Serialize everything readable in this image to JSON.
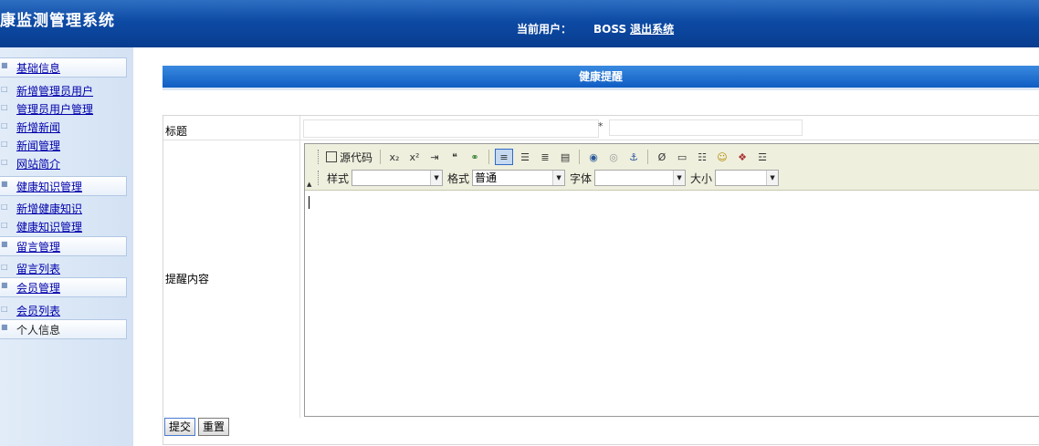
{
  "header": {
    "title": "康监测管理系统",
    "current_user_label": "当前用户：",
    "user_name": "BOSS",
    "logout_label": "退出系统"
  },
  "sidebar": {
    "sections": [
      {
        "label": "基础信息",
        "items": [
          "新增管理员用户",
          "管理员用户管理",
          "新增新闻",
          "新闻管理",
          "网站简介"
        ]
      },
      {
        "label": "健康知识管理",
        "items": [
          "新增健康知识",
          "健康知识管理"
        ]
      },
      {
        "label": "留言管理",
        "items": [
          "留言列表"
        ]
      },
      {
        "label": "会员管理",
        "items": [
          "会员列表"
        ]
      },
      {
        "label": "个人信息",
        "items": []
      }
    ]
  },
  "panel": {
    "title": "健康提醒"
  },
  "form": {
    "title_label": "标题",
    "title_value": "",
    "required_mark": "*",
    "content_label": "提醒内容"
  },
  "editor": {
    "source_label": "源代码",
    "style_label": "样式",
    "style_value": "",
    "format_label": "格式",
    "format_value": "普通",
    "font_label": "字体",
    "font_value": "",
    "size_label": "大小",
    "size_value": "",
    "toolbar_icons": [
      "subscript-icon",
      "superscript-icon",
      "indent-icon",
      "blockquote-icon",
      "link-icon",
      "align-left-icon",
      "align-center-icon",
      "align-right-icon",
      "align-justify-icon",
      "image-icon",
      "flash-icon",
      "anchor-icon",
      "special-char-icon",
      "table-icon",
      "horizontal-rule-icon",
      "smiley-icon",
      "insert-object-icon",
      "page-break-icon"
    ]
  },
  "buttons": {
    "submit": "提交",
    "reset": "重置"
  }
}
